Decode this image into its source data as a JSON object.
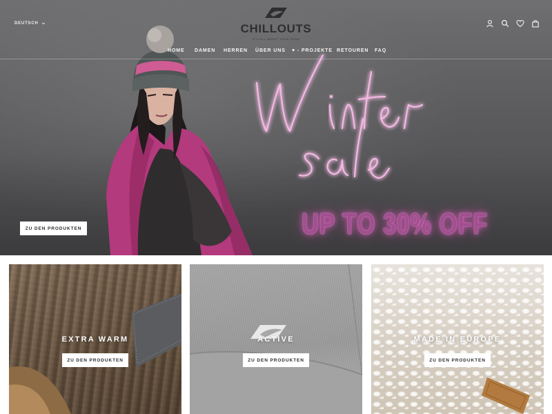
{
  "header": {
    "language": "DEUTSCH",
    "logo_text": "CHILLOUTS",
    "logo_tagline": "IT'S ALL ABOUT YOUR HEAD",
    "nav": [
      "HOME",
      "DAMEN",
      "HERREN",
      "ÜBER UNS",
      "♥ - PROJEKTE",
      "RETOUREN",
      "FAQ"
    ],
    "icons": [
      "account-icon",
      "search-icon",
      "heart-icon",
      "bag-icon"
    ]
  },
  "hero": {
    "neon_line1": "Winter",
    "neon_line2": "sale",
    "promo": "UP TO 30% OFF",
    "button": "ZU DEN PRODUKTEN"
  },
  "tiles": [
    {
      "title": "EXTRA WARM",
      "button": "ZU DEN PRODUKTEN"
    },
    {
      "title": "ACTIVE",
      "button": "ZU DEN PRODUKTEN"
    },
    {
      "title": "MADE IN EUROPE",
      "button": "ZU DEN PRODUKTEN"
    }
  ],
  "colors": {
    "neon_pink": "#f3b9e3",
    "promo_pink": "#a1508f",
    "jacket_pink": "#b23a7d",
    "text_light": "#f4f4f4",
    "logo_dark": "#2e2e30"
  }
}
